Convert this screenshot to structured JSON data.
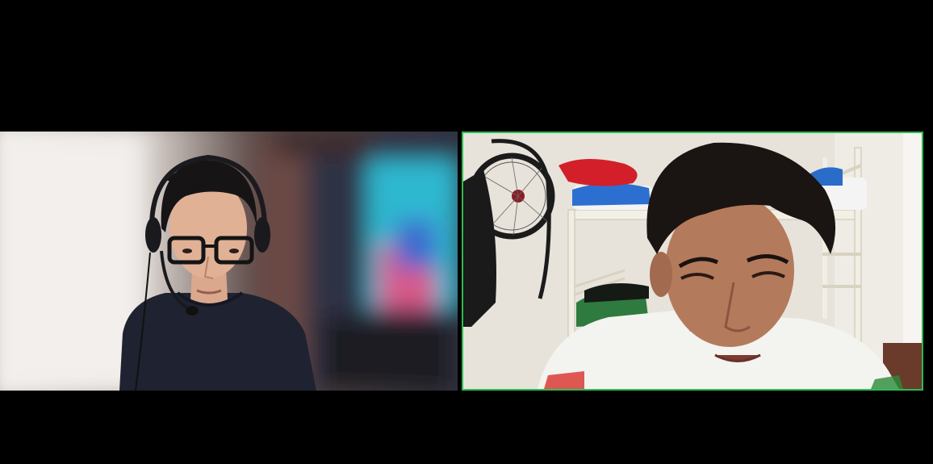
{
  "call": {
    "layout": "gallery",
    "background_color": "#000000",
    "active_speaker_border_color": "#2fbb4f"
  },
  "participants": [
    {
      "name": "",
      "video": "on",
      "background": "blurred",
      "headset": true,
      "glasses": true,
      "active_speaker": false
    },
    {
      "name": "",
      "video": "on",
      "background": "room",
      "headset": false,
      "glasses": false,
      "active_speaker": true
    }
  ]
}
